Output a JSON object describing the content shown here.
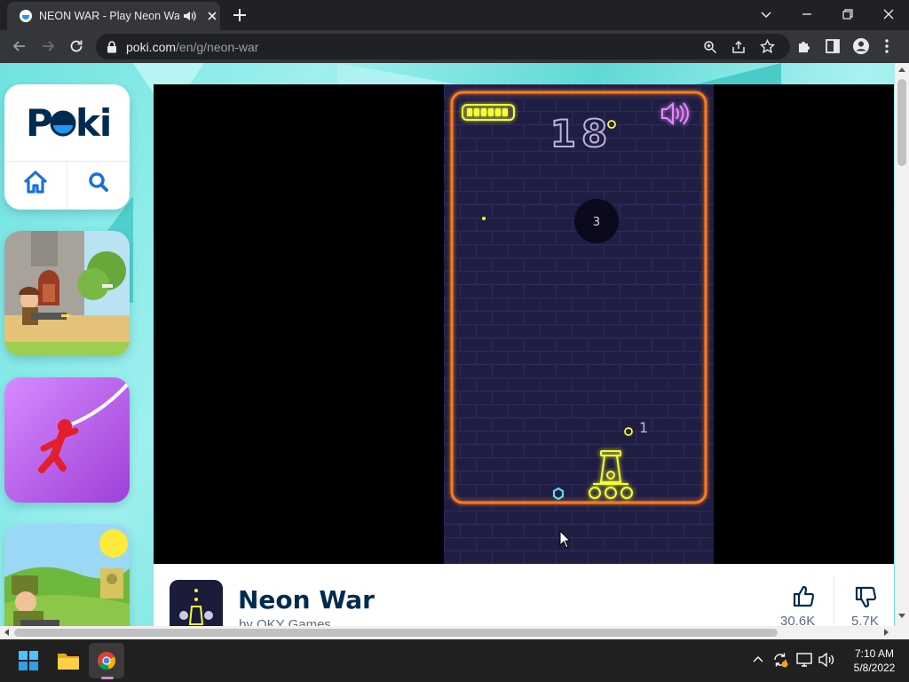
{
  "browser": {
    "tab_title": "NEON WAR - Play Neon War",
    "url_host": "poki.com",
    "url_path": "/en/g/neon-war",
    "icons": [
      "speaker-icon",
      "close-icon",
      "plus-icon",
      "chevron-down-icon",
      "minimize-icon",
      "restore-icon",
      "close-icon",
      "back-arrow-icon",
      "forward-arrow-icon",
      "reload-icon",
      "lock-icon",
      "zoom-icon",
      "share-icon",
      "star-icon",
      "puzzle-icon",
      "sidebar-icon",
      "profile-icon",
      "kebab-menu-icon"
    ]
  },
  "page": {
    "logo_text": "POKI",
    "sidebar_icons": [
      "home-icon",
      "search-icon"
    ],
    "colors": {
      "brand_navy": "#002b50",
      "brand_blue": "#2196f3",
      "background_teal": "#6fe3df"
    }
  },
  "game": {
    "score": "18",
    "bubble_value": "3",
    "shot_count": "1",
    "colors": {
      "frame": "#ff7a1a",
      "hud": "#f6ff2e",
      "sound": "#e987ff",
      "dot": "#64d8f0"
    }
  },
  "game_info": {
    "title": "Neon War",
    "author": "by OKY Games",
    "likes": "30.6K",
    "dislikes": "5.7K"
  },
  "taskbar": {
    "time": "7:10 AM",
    "date": "5/8/2022",
    "icons": [
      "windows-start-icon",
      "file-explorer-icon",
      "chrome-icon",
      "chevron-up-icon",
      "sync-icon",
      "display-icon",
      "volume-icon"
    ]
  }
}
